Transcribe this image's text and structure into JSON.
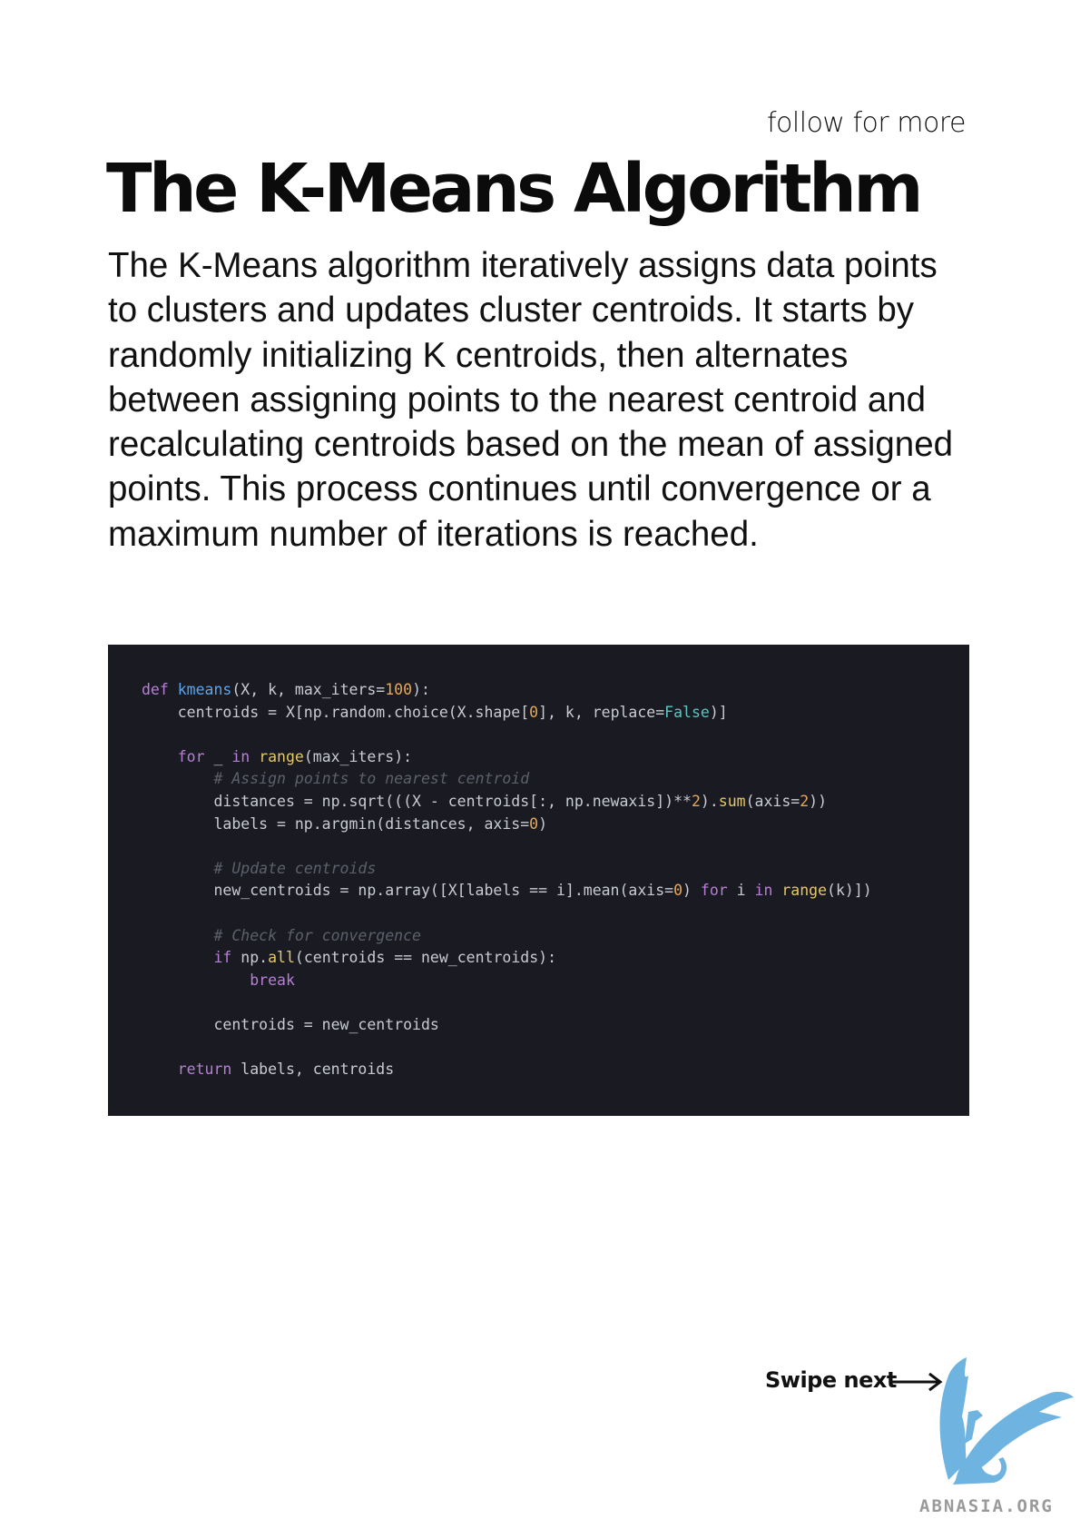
{
  "header": {
    "follow_label": "follow for more"
  },
  "title": "The K-Means Algorithm",
  "description": "The K-Means algorithm iteratively assigns data points to clusters and updates cluster centroids. It starts by randomly initializing K centroids, then alternates between assigning points to the nearest centroid and recalculating centroids based on the mean of assigned points. This process continues until convergence or a maximum number of iterations is reached.",
  "code": {
    "language": "python",
    "background": "#1a1b22",
    "lines": [
      [
        [
          "def",
          "kw"
        ],
        [
          " ",
          ""
        ],
        [
          "kmeans",
          "fn"
        ],
        [
          "(X, k, max_iters=",
          ""
        ],
        [
          "100",
          "num"
        ],
        [
          "):",
          ""
        ]
      ],
      [
        [
          "    centroids = X[np.random.choice(X.shape[",
          ""
        ],
        [
          "0",
          "num"
        ],
        [
          "], k, replace=",
          ""
        ],
        [
          "False",
          "bool"
        ],
        [
          ")]",
          ""
        ]
      ],
      [],
      [
        [
          "    ",
          ""
        ],
        [
          "for",
          "kw"
        ],
        [
          " _ ",
          ""
        ],
        [
          "in",
          "kw"
        ],
        [
          " ",
          ""
        ],
        [
          "range",
          "bi"
        ],
        [
          "(max_iters):",
          ""
        ]
      ],
      [
        [
          "        ",
          ""
        ],
        [
          "# Assign points to nearest centroid",
          "cm"
        ]
      ],
      [
        [
          "        distances = np.sqrt(((X - centroids[:, np.newaxis])**",
          ""
        ],
        [
          "2",
          "num"
        ],
        [
          ").",
          ""
        ],
        [
          "sum",
          "bi"
        ],
        [
          "(axis=",
          ""
        ],
        [
          "2",
          "num"
        ],
        [
          "))",
          ""
        ]
      ],
      [
        [
          "        labels = np.argmin(distances, axis=",
          ""
        ],
        [
          "0",
          "num"
        ],
        [
          ")",
          ""
        ]
      ],
      [],
      [
        [
          "        ",
          ""
        ],
        [
          "# Update centroids",
          "cm"
        ]
      ],
      [
        [
          "        new_centroids = np.array([X[labels == i].mean(axis=",
          ""
        ],
        [
          "0",
          "num"
        ],
        [
          ") ",
          ""
        ],
        [
          "for",
          "kw"
        ],
        [
          " i ",
          ""
        ],
        [
          "in",
          "kw"
        ],
        [
          " ",
          ""
        ],
        [
          "range",
          "bi"
        ],
        [
          "(k)])",
          ""
        ]
      ],
      [],
      [
        [
          "        ",
          ""
        ],
        [
          "# Check for convergence",
          "cm"
        ]
      ],
      [
        [
          "        ",
          ""
        ],
        [
          "if",
          "kw"
        ],
        [
          " np.",
          ""
        ],
        [
          "all",
          "bi"
        ],
        [
          "(centroids == new_centroids):",
          ""
        ]
      ],
      [
        [
          "            ",
          ""
        ],
        [
          "break",
          "kw"
        ]
      ],
      [],
      [
        [
          "        centroids = new_centroids",
          ""
        ]
      ],
      [],
      [
        [
          "    ",
          ""
        ],
        [
          "return",
          "kw"
        ],
        [
          " labels, centroids",
          ""
        ]
      ]
    ]
  },
  "footer": {
    "swipe_label": "Swipe next",
    "watermark": "ABNASIA.ORG",
    "logo_color": "#6fb4e0"
  }
}
